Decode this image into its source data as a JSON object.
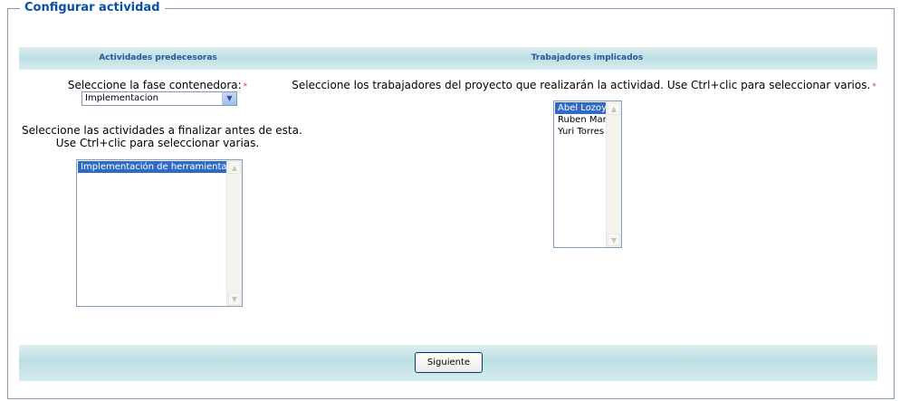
{
  "form": {
    "legend": "Configurar actividad",
    "predecessors": {
      "header": "Actividades predecesoras",
      "phase_label": "Seleccione la fase contenedora:",
      "required_mark": "*",
      "phase_selected": "Implementacion",
      "activities_hint_line1": "Seleccione las actividades a finalizar antes de esta.",
      "activities_hint_line2": "Use Ctrl+clic para seleccionar varias.",
      "activities": [
        {
          "label": "Implementación de herramienta",
          "selected": true
        }
      ]
    },
    "workers": {
      "header": "Trabajadores implicados",
      "hint": "Seleccione los trabajadores del proyecto que realizarán la actividad. Use Ctrl+clic para seleccionar varios.",
      "required_mark": "*",
      "list": [
        {
          "label": "Abel Lozoya",
          "selected": true
        },
        {
          "label": "Ruben Martin",
          "selected": false
        },
        {
          "label": "Yuri Torres",
          "selected": false
        }
      ]
    },
    "submit_label": "Siguiente"
  }
}
